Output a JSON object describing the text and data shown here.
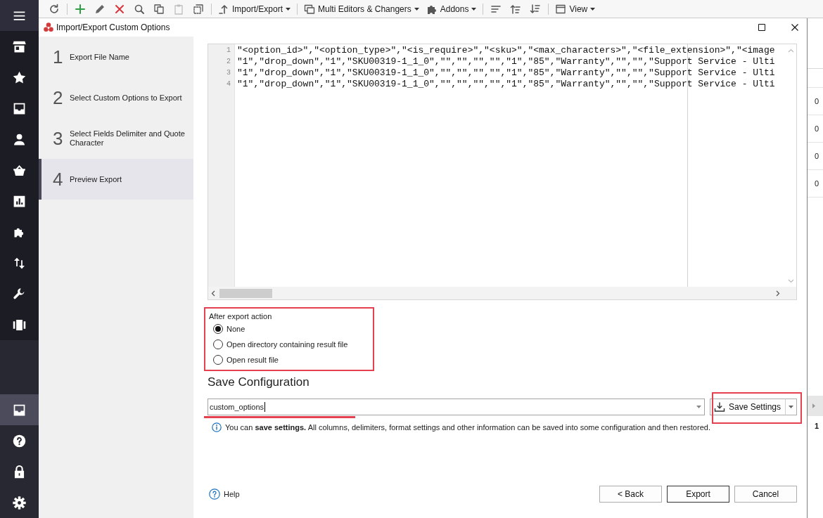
{
  "sidebar": {
    "top_items": [
      {
        "selected": false
      },
      {
        "selected": false
      },
      {
        "selected": false
      },
      {
        "selected": false
      },
      {
        "selected": false
      },
      {
        "selected": false
      },
      {
        "selected": false
      },
      {
        "selected": false
      },
      {
        "selected": false
      },
      {
        "selected": false
      }
    ],
    "bottom_items": [
      {
        "selected": true
      },
      {
        "selected": false
      },
      {
        "selected": false
      },
      {
        "selected": false
      }
    ]
  },
  "toolbar": {
    "items": [
      {
        "kind": "icon",
        "disabled": false
      },
      {
        "kind": "separator"
      },
      {
        "kind": "icon",
        "disabled": false
      },
      {
        "kind": "icon",
        "disabled": false
      },
      {
        "kind": "icon",
        "disabled": false
      },
      {
        "kind": "icon",
        "disabled": false
      },
      {
        "kind": "icon",
        "disabled": false
      },
      {
        "kind": "icon",
        "disabled": true
      },
      {
        "kind": "icon",
        "disabled": false
      },
      {
        "kind": "separator"
      },
      {
        "kind": "menu",
        "label": "Import/Export"
      },
      {
        "kind": "separator"
      },
      {
        "kind": "menu",
        "label": "Multi Editors & Changers"
      },
      {
        "kind": "menu",
        "label": "Addons"
      },
      {
        "kind": "separator"
      },
      {
        "kind": "icon",
        "disabled": false
      },
      {
        "kind": "icon",
        "disabled": false
      },
      {
        "kind": "icon",
        "disabled": false
      },
      {
        "kind": "separator"
      },
      {
        "kind": "menu",
        "label": "View"
      }
    ]
  },
  "dialog": {
    "title": "Import/Export Custom Options",
    "steps": [
      {
        "number": "1",
        "label": "Export File Name",
        "selected": false
      },
      {
        "number": "2",
        "label": "Select Custom Options to Export",
        "selected": false
      },
      {
        "number": "3",
        "label": "Select Fields Delimiter and Quote Character",
        "selected": false
      },
      {
        "number": "4",
        "label": "Preview Export",
        "selected": true
      }
    ],
    "preview": {
      "lines": [
        {
          "number": "1",
          "text": "\"<option_id>\",\"<option_type>\",\"<is_require>\",\"<sku>\",\"<max_characters>\",\"<file_extension>\",\"<image"
        },
        {
          "number": "2",
          "text": "\"1\",\"drop_down\",\"1\",\"SKU00319-1_1_0\",\"\",\"\",\"\",\"\",\"1\",\"85\",\"Warranty\",\"\",\"\",\"Support Service - Ulti"
        },
        {
          "number": "3",
          "text": "\"1\",\"drop_down\",\"1\",\"SKU00319-1_1_0\",\"\",\"\",\"\",\"\",\"1\",\"85\",\"Warranty\",\"\",\"\",\"Support Service - Ulti"
        },
        {
          "number": "4",
          "text": "\"1\",\"drop_down\",\"1\",\"SKU00319-1_1_0\",\"\",\"\",\"\",\"\",\"1\",\"85\",\"Warranty\",\"\",\"\",\"Support Service - Ulti"
        }
      ]
    },
    "after_export": {
      "label": "After export action",
      "highlighted": true,
      "options": [
        {
          "label": "None",
          "selected": true
        },
        {
          "label": "Open directory containing result file",
          "selected": false
        },
        {
          "label": "Open result file",
          "selected": false
        }
      ]
    },
    "save_configuration": {
      "heading": "Save Configuration",
      "value": "custom_options",
      "field_underlined": true,
      "button": "Save Settings",
      "button_highlighted": true,
      "info": "You can **save settings.** All columns, delimiters, format settings and other information can be saved into some configuration and then restored."
    },
    "help": "Help",
    "buttons": [
      {
        "label": "< Back",
        "default": false
      },
      {
        "label": "Export",
        "default": true
      },
      {
        "label": "Cancel",
        "default": false
      }
    ]
  },
  "background_grid": {
    "cells": [
      "0",
      "0",
      "0",
      "0"
    ],
    "total": "1"
  }
}
